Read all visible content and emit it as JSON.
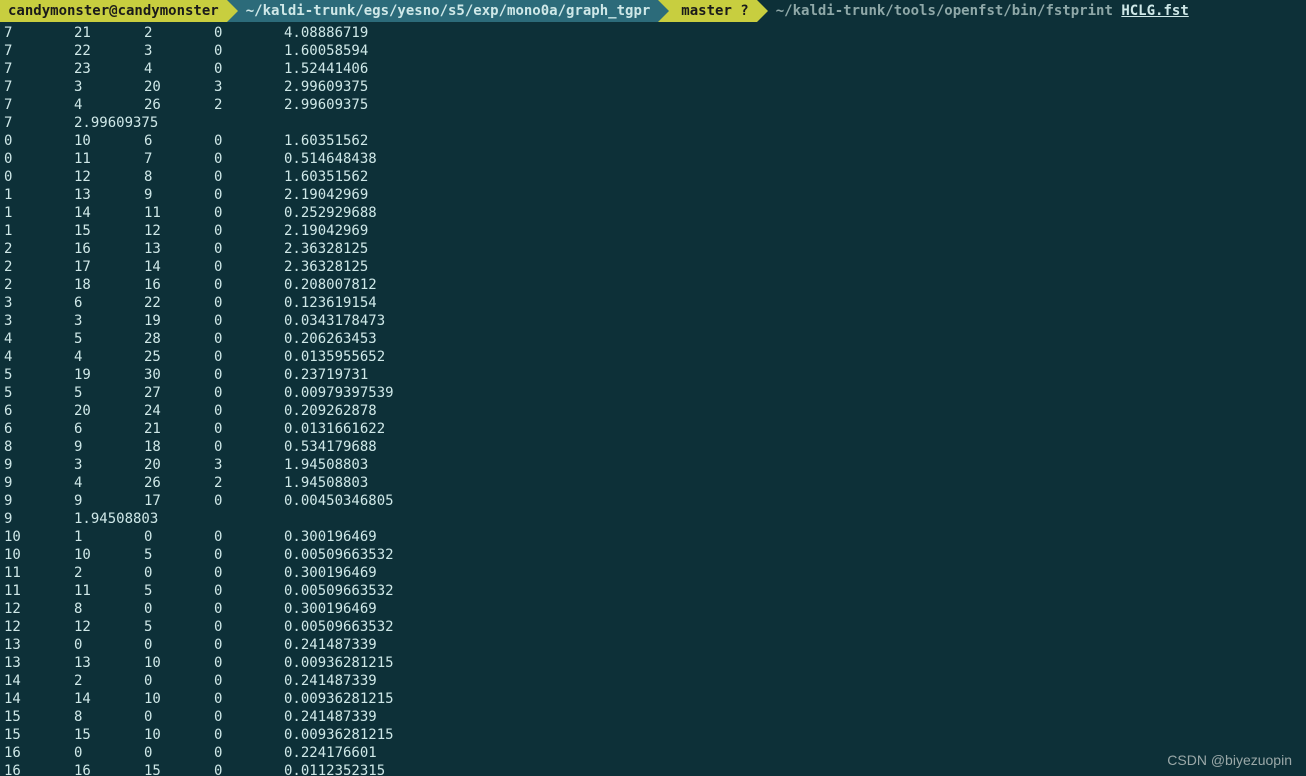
{
  "prompt": {
    "user": "candymonster@candymonster",
    "path": "~/kaldi-trunk/egs/yesno/s5/exp/mono0a/graph_tgpr",
    "branch": "master ?",
    "branch_icon": "",
    "cmd_prefix": "~/kaldi-trunk/tools/openfst/bin/fstprint",
    "cmd_arg": "HCLG.fst"
  },
  "rows": [
    [
      "7",
      "21",
      "2",
      "0",
      "4.08886719"
    ],
    [
      "7",
      "22",
      "3",
      "0",
      "1.60058594"
    ],
    [
      "7",
      "23",
      "4",
      "0",
      "1.52441406"
    ],
    [
      "7",
      "3",
      "20",
      "3",
      "2.99609375"
    ],
    [
      "7",
      "4",
      "26",
      "2",
      "2.99609375"
    ],
    [
      "7",
      "2.99609375",
      "",
      "",
      ""
    ],
    [
      "0",
      "10",
      "6",
      "0",
      "1.60351562"
    ],
    [
      "0",
      "11",
      "7",
      "0",
      "0.514648438"
    ],
    [
      "0",
      "12",
      "8",
      "0",
      "1.60351562"
    ],
    [
      "1",
      "13",
      "9",
      "0",
      "2.19042969"
    ],
    [
      "1",
      "14",
      "11",
      "0",
      "0.252929688"
    ],
    [
      "1",
      "15",
      "12",
      "0",
      "2.19042969"
    ],
    [
      "2",
      "16",
      "13",
      "0",
      "2.36328125"
    ],
    [
      "2",
      "17",
      "14",
      "0",
      "2.36328125"
    ],
    [
      "2",
      "18",
      "16",
      "0",
      "0.208007812"
    ],
    [
      "3",
      "6",
      "22",
      "0",
      "0.123619154"
    ],
    [
      "3",
      "3",
      "19",
      "0",
      "0.0343178473"
    ],
    [
      "4",
      "5",
      "28",
      "0",
      "0.206263453"
    ],
    [
      "4",
      "4",
      "25",
      "0",
      "0.0135955652"
    ],
    [
      "5",
      "19",
      "30",
      "0",
      "0.23719731"
    ],
    [
      "5",
      "5",
      "27",
      "0",
      "0.00979397539"
    ],
    [
      "6",
      "20",
      "24",
      "0",
      "0.209262878"
    ],
    [
      "6",
      "6",
      "21",
      "0",
      "0.0131661622"
    ],
    [
      "8",
      "9",
      "18",
      "0",
      "0.534179688"
    ],
    [
      "9",
      "3",
      "20",
      "3",
      "1.94508803"
    ],
    [
      "9",
      "4",
      "26",
      "2",
      "1.94508803"
    ],
    [
      "9",
      "9",
      "17",
      "0",
      "0.00450346805"
    ],
    [
      "9",
      "1.94508803",
      "",
      "",
      ""
    ],
    [
      "10",
      "1",
      "0",
      "0",
      "0.300196469"
    ],
    [
      "10",
      "10",
      "5",
      "0",
      "0.00509663532"
    ],
    [
      "11",
      "2",
      "0",
      "0",
      "0.300196469"
    ],
    [
      "11",
      "11",
      "5",
      "0",
      "0.00509663532"
    ],
    [
      "12",
      "8",
      "0",
      "0",
      "0.300196469"
    ],
    [
      "12",
      "12",
      "5",
      "0",
      "0.00509663532"
    ],
    [
      "13",
      "0",
      "0",
      "0",
      "0.241487339"
    ],
    [
      "13",
      "13",
      "10",
      "0",
      "0.00936281215"
    ],
    [
      "14",
      "2",
      "0",
      "0",
      "0.241487339"
    ],
    [
      "14",
      "14",
      "10",
      "0",
      "0.00936281215"
    ],
    [
      "15",
      "8",
      "0",
      "0",
      "0.241487339"
    ],
    [
      "15",
      "15",
      "10",
      "0",
      "0.00936281215"
    ],
    [
      "16",
      "0",
      "0",
      "0",
      "0.224176601"
    ],
    [
      "16",
      "16",
      "15",
      "0",
      "0.0112352315"
    ]
  ],
  "watermark": "CSDN @biyezuopin"
}
